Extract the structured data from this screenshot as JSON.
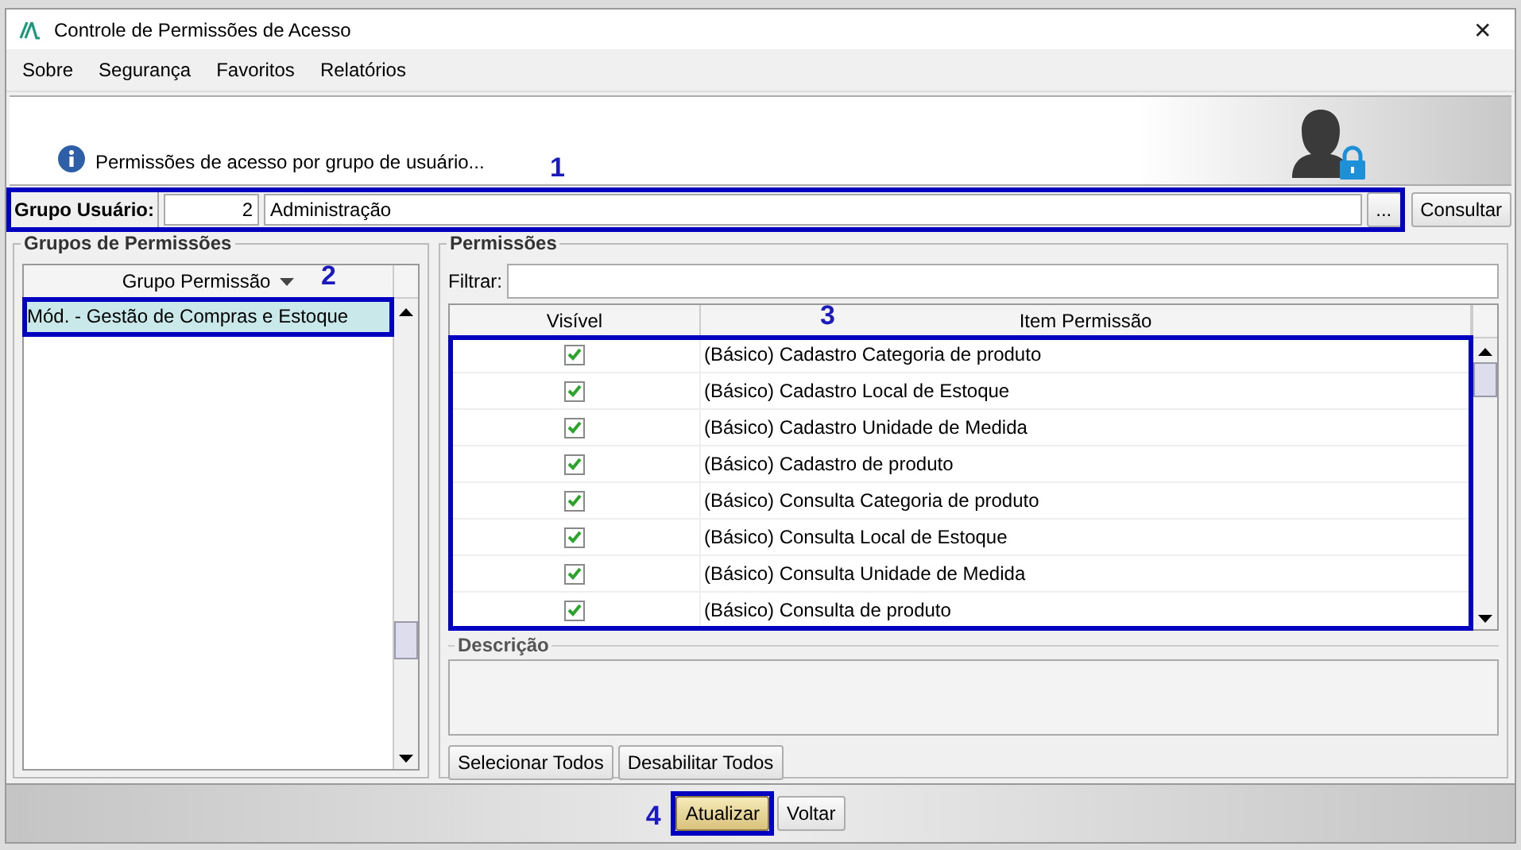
{
  "window": {
    "title": "Controle de Permissões de Acesso",
    "close": "✕"
  },
  "menu": [
    {
      "label": "Sobre"
    },
    {
      "label": "Segurança"
    },
    {
      "label": "Favoritos"
    },
    {
      "label": "Relatórios"
    }
  ],
  "header": {
    "message": "Permissões de acesso por grupo de usuário..."
  },
  "user_group": {
    "label": "Grupo Usuário:",
    "code": "2",
    "name": "Administração",
    "lookup_button": "...",
    "query_button": "Consultar"
  },
  "groups_panel": {
    "title": "Grupos de Permissões",
    "column": "Grupo Permissão",
    "rows": [
      {
        "label": "Mód. - Gestão de Compras e Estoque",
        "selected": true
      }
    ]
  },
  "permissions_panel": {
    "title": "Permissões",
    "filter_label": "Filtrar:",
    "columns": [
      "Visível",
      "Item Permissão"
    ],
    "rows": [
      {
        "visible": true,
        "item": "(Básico) Cadastro Categoria de produto"
      },
      {
        "visible": true,
        "item": "(Básico) Cadastro Local de Estoque"
      },
      {
        "visible": true,
        "item": "(Básico) Cadastro Unidade de Medida"
      },
      {
        "visible": true,
        "item": "(Básico) Cadastro de produto"
      },
      {
        "visible": true,
        "item": "(Básico) Consulta Categoria de produto"
      },
      {
        "visible": true,
        "item": "(Básico) Consulta Local de Estoque"
      },
      {
        "visible": true,
        "item": "(Básico) Consulta Unidade de Medida"
      },
      {
        "visible": true,
        "item": "(Básico) Consulta de produto"
      }
    ],
    "description_label": "Descrição",
    "buttons": [
      "Selecionar Todos",
      "Desabilitar Todos"
    ]
  },
  "footer": {
    "buttons": [
      {
        "label": "Atualizar",
        "default": true
      },
      {
        "label": "Voltar",
        "default": false
      }
    ]
  },
  "annotations": [
    {
      "number": "1"
    },
    {
      "number": "2"
    },
    {
      "number": "3"
    },
    {
      "number": "4"
    }
  ]
}
